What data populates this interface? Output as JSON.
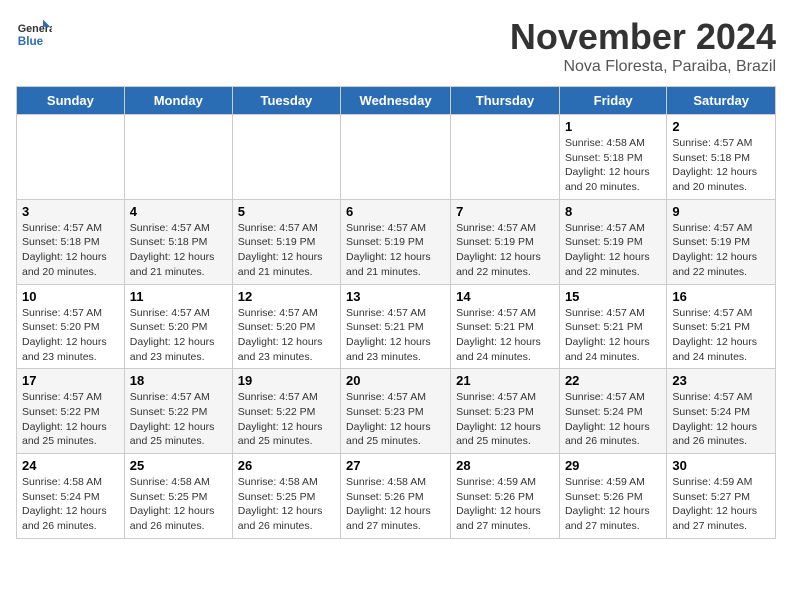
{
  "header": {
    "logo_line1": "General",
    "logo_line2": "Blue",
    "month_title": "November 2024",
    "location": "Nova Floresta, Paraiba, Brazil"
  },
  "days_of_week": [
    "Sunday",
    "Monday",
    "Tuesday",
    "Wednesday",
    "Thursday",
    "Friday",
    "Saturday"
  ],
  "weeks": [
    [
      {
        "day": "",
        "info": ""
      },
      {
        "day": "",
        "info": ""
      },
      {
        "day": "",
        "info": ""
      },
      {
        "day": "",
        "info": ""
      },
      {
        "day": "",
        "info": ""
      },
      {
        "day": "1",
        "info": "Sunrise: 4:58 AM\nSunset: 5:18 PM\nDaylight: 12 hours and 20 minutes."
      },
      {
        "day": "2",
        "info": "Sunrise: 4:57 AM\nSunset: 5:18 PM\nDaylight: 12 hours and 20 minutes."
      }
    ],
    [
      {
        "day": "3",
        "info": "Sunrise: 4:57 AM\nSunset: 5:18 PM\nDaylight: 12 hours and 20 minutes."
      },
      {
        "day": "4",
        "info": "Sunrise: 4:57 AM\nSunset: 5:18 PM\nDaylight: 12 hours and 21 minutes."
      },
      {
        "day": "5",
        "info": "Sunrise: 4:57 AM\nSunset: 5:19 PM\nDaylight: 12 hours and 21 minutes."
      },
      {
        "day": "6",
        "info": "Sunrise: 4:57 AM\nSunset: 5:19 PM\nDaylight: 12 hours and 21 minutes."
      },
      {
        "day": "7",
        "info": "Sunrise: 4:57 AM\nSunset: 5:19 PM\nDaylight: 12 hours and 22 minutes."
      },
      {
        "day": "8",
        "info": "Sunrise: 4:57 AM\nSunset: 5:19 PM\nDaylight: 12 hours and 22 minutes."
      },
      {
        "day": "9",
        "info": "Sunrise: 4:57 AM\nSunset: 5:19 PM\nDaylight: 12 hours and 22 minutes."
      }
    ],
    [
      {
        "day": "10",
        "info": "Sunrise: 4:57 AM\nSunset: 5:20 PM\nDaylight: 12 hours and 23 minutes."
      },
      {
        "day": "11",
        "info": "Sunrise: 4:57 AM\nSunset: 5:20 PM\nDaylight: 12 hours and 23 minutes."
      },
      {
        "day": "12",
        "info": "Sunrise: 4:57 AM\nSunset: 5:20 PM\nDaylight: 12 hours and 23 minutes."
      },
      {
        "day": "13",
        "info": "Sunrise: 4:57 AM\nSunset: 5:21 PM\nDaylight: 12 hours and 23 minutes."
      },
      {
        "day": "14",
        "info": "Sunrise: 4:57 AM\nSunset: 5:21 PM\nDaylight: 12 hours and 24 minutes."
      },
      {
        "day": "15",
        "info": "Sunrise: 4:57 AM\nSunset: 5:21 PM\nDaylight: 12 hours and 24 minutes."
      },
      {
        "day": "16",
        "info": "Sunrise: 4:57 AM\nSunset: 5:21 PM\nDaylight: 12 hours and 24 minutes."
      }
    ],
    [
      {
        "day": "17",
        "info": "Sunrise: 4:57 AM\nSunset: 5:22 PM\nDaylight: 12 hours and 25 minutes."
      },
      {
        "day": "18",
        "info": "Sunrise: 4:57 AM\nSunset: 5:22 PM\nDaylight: 12 hours and 25 minutes."
      },
      {
        "day": "19",
        "info": "Sunrise: 4:57 AM\nSunset: 5:22 PM\nDaylight: 12 hours and 25 minutes."
      },
      {
        "day": "20",
        "info": "Sunrise: 4:57 AM\nSunset: 5:23 PM\nDaylight: 12 hours and 25 minutes."
      },
      {
        "day": "21",
        "info": "Sunrise: 4:57 AM\nSunset: 5:23 PM\nDaylight: 12 hours and 25 minutes."
      },
      {
        "day": "22",
        "info": "Sunrise: 4:57 AM\nSunset: 5:24 PM\nDaylight: 12 hours and 26 minutes."
      },
      {
        "day": "23",
        "info": "Sunrise: 4:57 AM\nSunset: 5:24 PM\nDaylight: 12 hours and 26 minutes."
      }
    ],
    [
      {
        "day": "24",
        "info": "Sunrise: 4:58 AM\nSunset: 5:24 PM\nDaylight: 12 hours and 26 minutes."
      },
      {
        "day": "25",
        "info": "Sunrise: 4:58 AM\nSunset: 5:25 PM\nDaylight: 12 hours and 26 minutes."
      },
      {
        "day": "26",
        "info": "Sunrise: 4:58 AM\nSunset: 5:25 PM\nDaylight: 12 hours and 26 minutes."
      },
      {
        "day": "27",
        "info": "Sunrise: 4:58 AM\nSunset: 5:26 PM\nDaylight: 12 hours and 27 minutes."
      },
      {
        "day": "28",
        "info": "Sunrise: 4:59 AM\nSunset: 5:26 PM\nDaylight: 12 hours and 27 minutes."
      },
      {
        "day": "29",
        "info": "Sunrise: 4:59 AM\nSunset: 5:26 PM\nDaylight: 12 hours and 27 minutes."
      },
      {
        "day": "30",
        "info": "Sunrise: 4:59 AM\nSunset: 5:27 PM\nDaylight: 12 hours and 27 minutes."
      }
    ]
  ]
}
